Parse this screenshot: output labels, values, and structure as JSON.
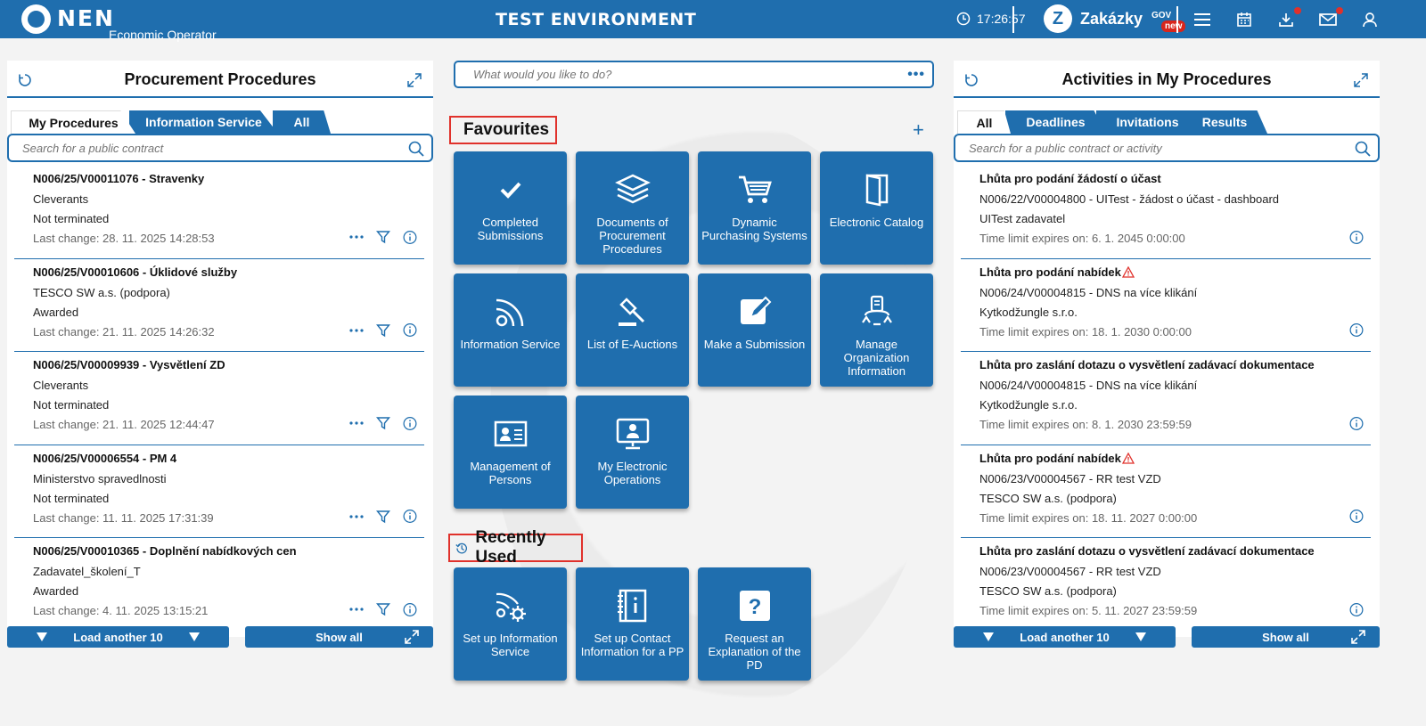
{
  "header": {
    "logo_text": "NEN",
    "logo_subtitle": "Economic Operator",
    "environment": "TEST ENVIRONMENT",
    "time": "17:26:57",
    "zakazky_label": "Zakázky",
    "zakazky_gov": "GOV",
    "zakazky_new": "new"
  },
  "left_panel": {
    "title": "Procurement Procedures",
    "tabs": [
      "My Procedures",
      "Information Service",
      "All"
    ],
    "search_placeholder": "Search for a public contract",
    "items": [
      {
        "title": "N006/25/V00011076 - Stravenky",
        "org": "Cleverants",
        "status": "Not terminated",
        "changed": "Last change: 28. 11. 2025 14:28:53"
      },
      {
        "title": "N006/25/V00010606 - Úklidové služby",
        "org": "TESCO SW a.s. (podpora)",
        "status": "Awarded",
        "changed": "Last change: 21. 11. 2025 14:26:32"
      },
      {
        "title": "N006/25/V00009939 - Vysvětlení ZD",
        "org": "Cleverants",
        "status": "Not terminated",
        "changed": "Last change: 21. 11. 2025 12:44:47"
      },
      {
        "title": "N006/25/V00006554 - PM 4",
        "org": "Ministerstvo spravedlnosti",
        "status": "Not terminated",
        "changed": "Last change: 11. 11. 2025 17:31:39"
      },
      {
        "title": "N006/25/V00010365 - Doplnění nabídkových cen",
        "org": "Zadavatel_školení_T",
        "status": "Awarded",
        "changed": "Last change: 4. 11. 2025 13:15:21"
      }
    ],
    "load_more": "Load another 10",
    "show_all": "Show all"
  },
  "center": {
    "quick_placeholder": "What would you like to do?",
    "quick_dots": "•••",
    "favourites_title": "Favourites",
    "plus": "+",
    "favourites": [
      {
        "label": "Completed Submissions",
        "icon": "check-icon"
      },
      {
        "label": "Documents of Procurement Procedures",
        "icon": "layers-icon"
      },
      {
        "label": "Dynamic Purchasing Systems",
        "icon": "cart-icon"
      },
      {
        "label": "Electronic Catalog",
        "icon": "book-icon"
      },
      {
        "label": "Information Service",
        "icon": "feed-icon"
      },
      {
        "label": "List of E-Auctions",
        "icon": "gavel-icon"
      },
      {
        "label": "Make a Submission",
        "icon": "edit-icon"
      },
      {
        "label": "Manage Organization Information",
        "icon": "org-icon"
      },
      {
        "label": "Management of Persons",
        "icon": "id-card-icon"
      },
      {
        "label": "My Electronic Operations",
        "icon": "monitor-user-icon"
      }
    ],
    "recent_title": "Recently Used",
    "recent": [
      {
        "label": "Set up Information Service",
        "icon": "feed-gear-icon"
      },
      {
        "label": "Set up Contact Information for a PP",
        "icon": "contact-book-icon"
      },
      {
        "label": "Request an Explanation of the PD",
        "icon": "question-icon"
      }
    ]
  },
  "right_panel": {
    "title": "Activities in My Procedures",
    "tabs": [
      "All",
      "Deadlines",
      "Invitations",
      "Results"
    ],
    "search_placeholder": "Search for a public contract or activity",
    "items": [
      {
        "title": "Lhůta pro podání žádostí o účast",
        "warn": false,
        "ref": "N006/22/V00004800 - UITest - žádost o účast - dashboard",
        "org": "UITest zadavatel",
        "limit": "Time limit expires on: 6. 1. 2045 0:00:00"
      },
      {
        "title": "Lhůta pro podání nabídek",
        "warn": true,
        "ref": "N006/24/V00004815 - DNS na více klikání",
        "org": "Kytkodžungle s.r.o.",
        "limit": "Time limit expires on: 18. 1. 2030 0:00:00"
      },
      {
        "title": "Lhůta pro zaslání dotazu o vysvětlení zadávací dokumentace",
        "warn": false,
        "ref": "N006/24/V00004815 - DNS na více klikání",
        "org": "Kytkodžungle s.r.o.",
        "limit": "Time limit expires on: 8. 1. 2030 23:59:59"
      },
      {
        "title": "Lhůta pro podání nabídek",
        "warn": true,
        "ref": "N006/23/V00004567 - RR test VZD",
        "org": "TESCO SW a.s. (podpora)",
        "limit": "Time limit expires on: 18. 11. 2027 0:00:00"
      },
      {
        "title": "Lhůta pro zaslání dotazu o vysvětlení zadávací dokumentace",
        "warn": false,
        "ref": "N006/23/V00004567 - RR test VZD",
        "org": "TESCO SW a.s. (podpora)",
        "limit": "Time limit expires on: 5. 11. 2027 23:59:59"
      }
    ],
    "load_more": "Load another 10",
    "show_all": "Show all"
  },
  "colors": {
    "primary": "#1f6eae",
    "highlight_border": "#e0312b",
    "badge_red": "#d9261c",
    "warning": "#e0312b"
  }
}
